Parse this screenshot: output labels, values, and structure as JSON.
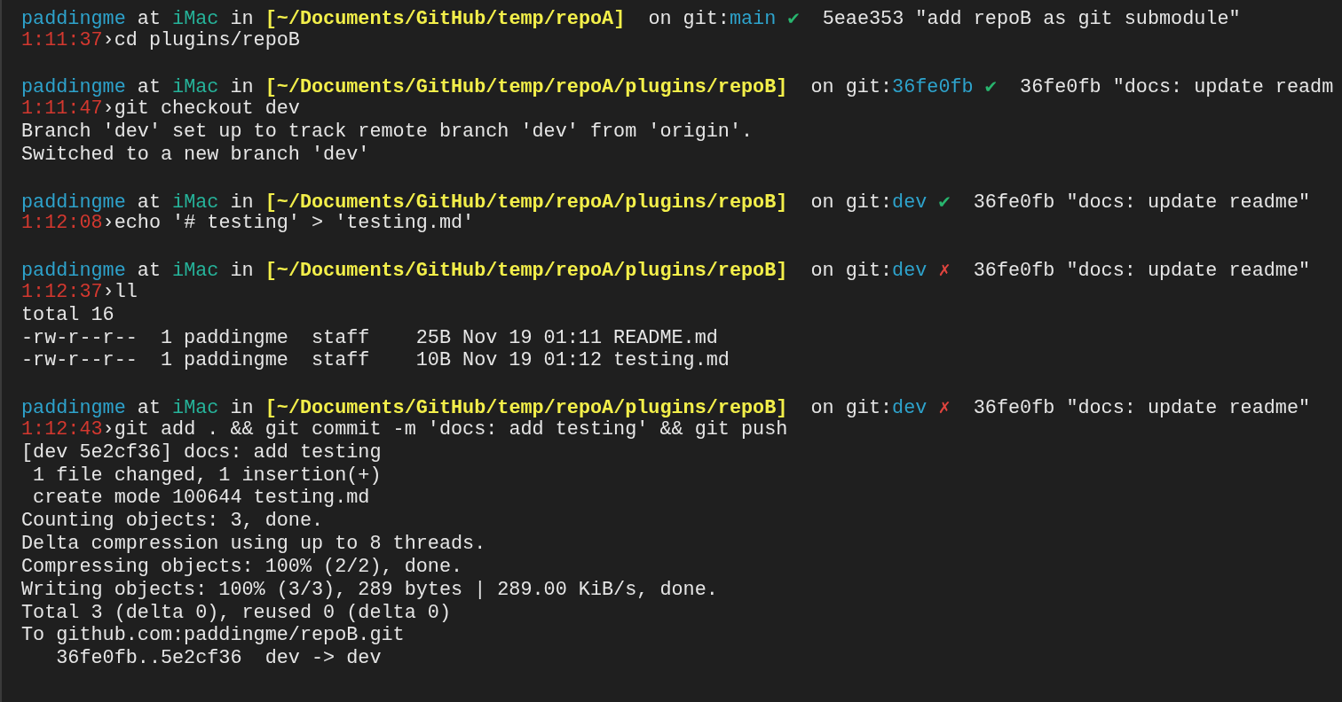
{
  "terminal": {
    "lines": [
      {
        "kind": "prompt",
        "segments": [
          {
            "kind": "user",
            "text": "paddingme"
          },
          {
            "kind": "plain",
            "text": " at "
          },
          {
            "kind": "host",
            "text": "iMac"
          },
          {
            "kind": "plain",
            "text": " in "
          },
          {
            "kind": "path",
            "text": "[~/Documents/GitHub/temp/repoA]"
          },
          {
            "kind": "plain",
            "text": "  on git:"
          },
          {
            "kind": "branch",
            "text": "main"
          },
          {
            "kind": "ok",
            "text": " ✔"
          },
          {
            "kind": "commit",
            "text": "  5eae353 \"add repoB as git submodule\""
          }
        ]
      },
      {
        "kind": "command",
        "time": "1:11:37",
        "arrow": "›",
        "command": "cd plugins/repoB"
      },
      {
        "kind": "blank"
      },
      {
        "kind": "prompt",
        "segments": [
          {
            "kind": "user",
            "text": "paddingme"
          },
          {
            "kind": "plain",
            "text": " at "
          },
          {
            "kind": "host",
            "text": "iMac"
          },
          {
            "kind": "plain",
            "text": " in "
          },
          {
            "kind": "path",
            "text": "[~/Documents/GitHub/temp/repoA/plugins/repoB]"
          },
          {
            "kind": "plain",
            "text": "  on git:"
          },
          {
            "kind": "branch",
            "text": "36fe0fb"
          },
          {
            "kind": "ok",
            "text": " ✔"
          },
          {
            "kind": "commit",
            "text": "  36fe0fb \"docs: update readm"
          }
        ]
      },
      {
        "kind": "command",
        "time": "1:11:47",
        "arrow": "›",
        "command": "git checkout dev"
      },
      {
        "kind": "output",
        "text": "Branch 'dev' set up to track remote branch 'dev' from 'origin'."
      },
      {
        "kind": "output",
        "text": "Switched to a new branch 'dev'"
      },
      {
        "kind": "blank"
      },
      {
        "kind": "prompt",
        "segments": [
          {
            "kind": "user",
            "text": "paddingme"
          },
          {
            "kind": "plain",
            "text": " at "
          },
          {
            "kind": "host",
            "text": "iMac"
          },
          {
            "kind": "plain",
            "text": " in "
          },
          {
            "kind": "path",
            "text": "[~/Documents/GitHub/temp/repoA/plugins/repoB]"
          },
          {
            "kind": "plain",
            "text": "  on git:"
          },
          {
            "kind": "branch",
            "text": "dev"
          },
          {
            "kind": "ok",
            "text": " ✔"
          },
          {
            "kind": "commit",
            "text": "  36fe0fb \"docs: update readme\""
          }
        ]
      },
      {
        "kind": "command",
        "time": "1:12:08",
        "arrow": "›",
        "command": "echo '# testing' > 'testing.md'"
      },
      {
        "kind": "blank"
      },
      {
        "kind": "prompt",
        "segments": [
          {
            "kind": "user",
            "text": "paddingme"
          },
          {
            "kind": "plain",
            "text": " at "
          },
          {
            "kind": "host",
            "text": "iMac"
          },
          {
            "kind": "plain",
            "text": " in "
          },
          {
            "kind": "path",
            "text": "[~/Documents/GitHub/temp/repoA/plugins/repoB]"
          },
          {
            "kind": "plain",
            "text": "  on git:"
          },
          {
            "kind": "branch",
            "text": "dev"
          },
          {
            "kind": "fail",
            "text": " ✗"
          },
          {
            "kind": "commit",
            "text": "  36fe0fb \"docs: update readme\""
          }
        ]
      },
      {
        "kind": "command",
        "time": "1:12:37",
        "arrow": "›",
        "command": "ll"
      },
      {
        "kind": "output",
        "text": "total 16"
      },
      {
        "kind": "output",
        "text": "-rw-r--r--  1 paddingme  staff    25B Nov 19 01:11 README.md"
      },
      {
        "kind": "output",
        "text": "-rw-r--r--  1 paddingme  staff    10B Nov 19 01:12 testing.md"
      },
      {
        "kind": "blank"
      },
      {
        "kind": "prompt",
        "segments": [
          {
            "kind": "user",
            "text": "paddingme"
          },
          {
            "kind": "plain",
            "text": " at "
          },
          {
            "kind": "host",
            "text": "iMac"
          },
          {
            "kind": "plain",
            "text": " in "
          },
          {
            "kind": "path",
            "text": "[~/Documents/GitHub/temp/repoA/plugins/repoB]"
          },
          {
            "kind": "plain",
            "text": "  on git:"
          },
          {
            "kind": "branch",
            "text": "dev"
          },
          {
            "kind": "fail",
            "text": " ✗"
          },
          {
            "kind": "commit",
            "text": "  36fe0fb \"docs: update readme\""
          }
        ]
      },
      {
        "kind": "command",
        "time": "1:12:43",
        "arrow": "›",
        "command": "git add . && git commit -m 'docs: add testing' && git push"
      },
      {
        "kind": "output",
        "text": "[dev 5e2cf36] docs: add testing"
      },
      {
        "kind": "output",
        "text": " 1 file changed, 1 insertion(+)"
      },
      {
        "kind": "output",
        "text": " create mode 100644 testing.md"
      },
      {
        "kind": "output",
        "text": "Counting objects: 3, done."
      },
      {
        "kind": "output",
        "text": "Delta compression using up to 8 threads."
      },
      {
        "kind": "output",
        "text": "Compressing objects: 100% (2/2), done."
      },
      {
        "kind": "output",
        "text": "Writing objects: 100% (3/3), 289 bytes | 289.00 KiB/s, done."
      },
      {
        "kind": "output",
        "text": "Total 3 (delta 0), reused 0 (delta 0)"
      },
      {
        "kind": "output",
        "text": "To github.com:paddingme/repoB.git"
      },
      {
        "kind": "output",
        "text": "   36fe0fb..5e2cf36  dev -> dev"
      }
    ]
  }
}
